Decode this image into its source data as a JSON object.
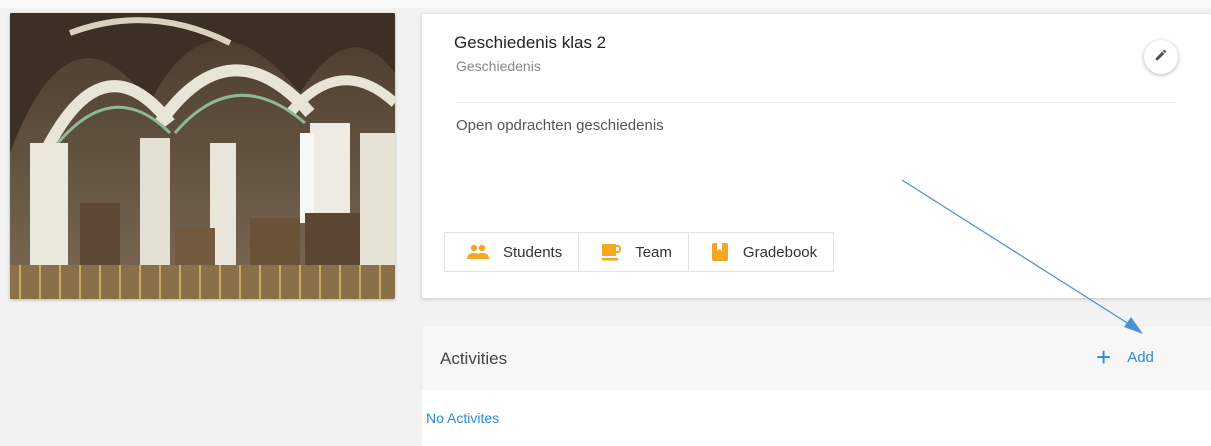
{
  "course": {
    "title": "Geschiedenis klas 2",
    "subject": "Geschiedenis",
    "description": "Open opdrachten geschiedenis"
  },
  "tabs": [
    {
      "label": "Students",
      "icon": "people-icon"
    },
    {
      "label": "Team",
      "icon": "coffee-icon"
    },
    {
      "label": "Gradebook",
      "icon": "book-icon"
    }
  ],
  "activities": {
    "title": "Activities",
    "add_label": "Add",
    "empty_text": "No Activites"
  },
  "colors": {
    "accent": "#2a8bd6",
    "icon_orange": "#f5a623",
    "arrow": "#4a8fd4"
  }
}
